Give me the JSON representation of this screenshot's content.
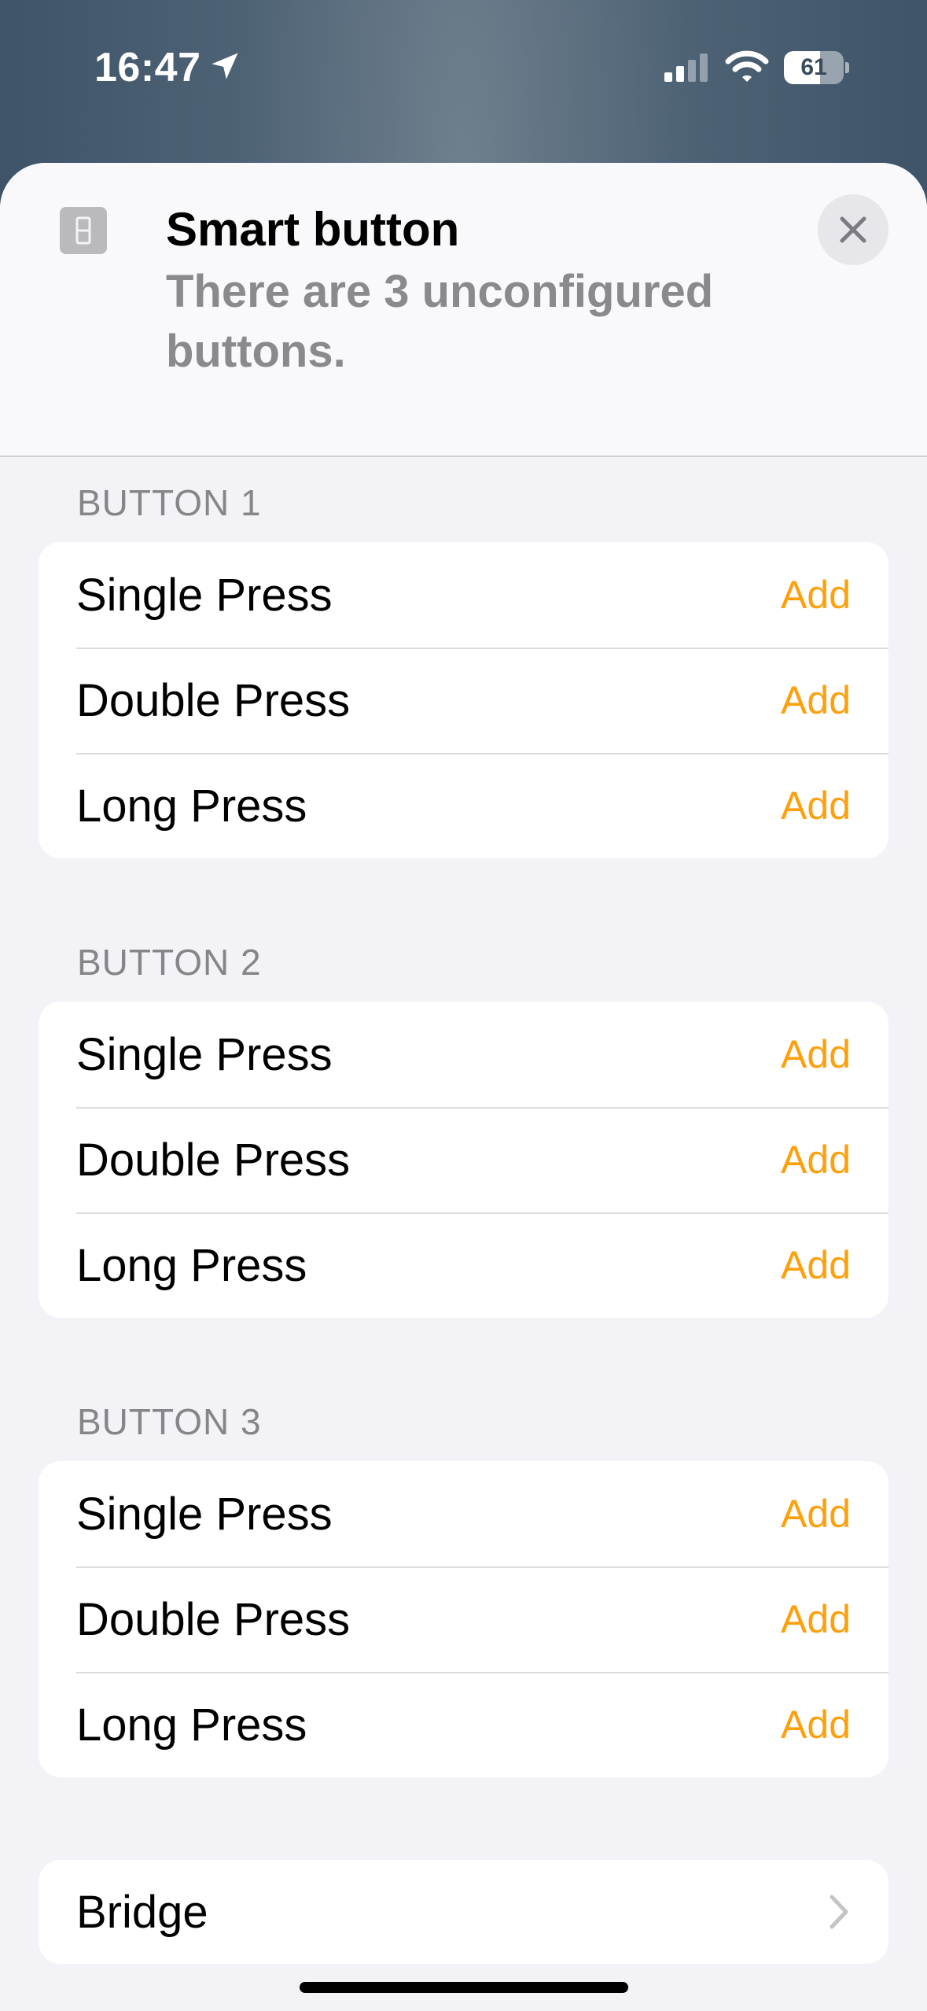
{
  "status_bar": {
    "time": "16:47",
    "battery_level": "61",
    "battery_fraction": 0.61,
    "icons": [
      "location-arrow-icon",
      "cellular-signal-icon",
      "wifi-icon",
      "battery-icon"
    ]
  },
  "header": {
    "icon": "device-icon",
    "title": "Smart button",
    "subtitle": "There are 3 unconfigured buttons.",
    "close_icon": "close-icon"
  },
  "sections": [
    {
      "title": "BUTTON 1",
      "rows": [
        {
          "label": "Single Press",
          "action": "Add"
        },
        {
          "label": "Double Press",
          "action": "Add"
        },
        {
          "label": "Long Press",
          "action": "Add"
        }
      ]
    },
    {
      "title": "BUTTON 2",
      "rows": [
        {
          "label": "Single Press",
          "action": "Add"
        },
        {
          "label": "Double Press",
          "action": "Add"
        },
        {
          "label": "Long Press",
          "action": "Add"
        }
      ]
    },
    {
      "title": "BUTTON 3",
      "rows": [
        {
          "label": "Single Press",
          "action": "Add"
        },
        {
          "label": "Double Press",
          "action": "Add"
        },
        {
          "label": "Long Press",
          "action": "Add"
        }
      ]
    }
  ],
  "bridge": {
    "label": "Bridge",
    "icon": "chevron-right-icon"
  },
  "colors": {
    "accent": "#ff9f0a",
    "sheet_background": "#f2f2f7",
    "secondary_text": "#8a8a8e"
  }
}
